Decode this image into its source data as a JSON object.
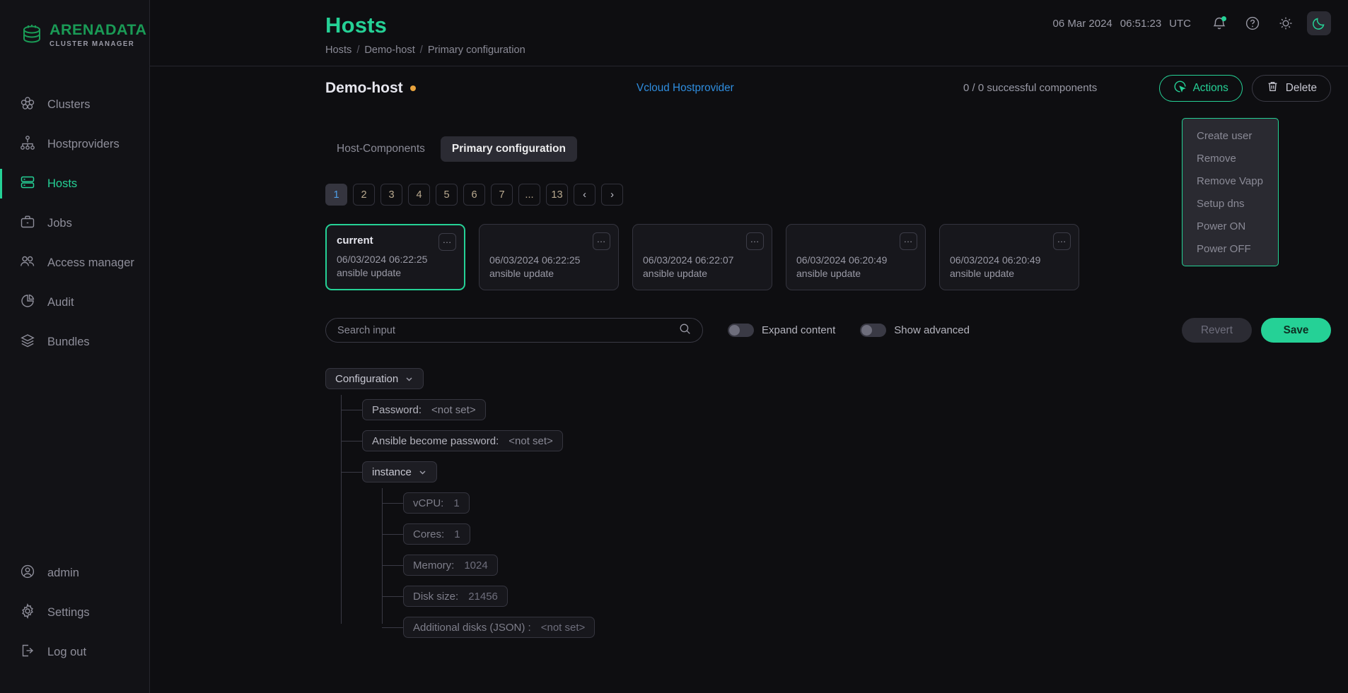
{
  "brand": {
    "name": "ARENADATA",
    "tagline": "CLUSTER MANAGER",
    "accent": "#25d196",
    "logo_icon": "database-stack-icon"
  },
  "sidebar": {
    "items": [
      {
        "label": "Clusters",
        "icon": "clusters-icon",
        "active": false
      },
      {
        "label": "Hostproviders",
        "icon": "hostproviders-icon",
        "active": false
      },
      {
        "label": "Hosts",
        "icon": "hosts-icon",
        "active": true
      },
      {
        "label": "Jobs",
        "icon": "jobs-briefcase-icon",
        "active": false
      },
      {
        "label": "Access manager",
        "icon": "users-icon",
        "active": false
      },
      {
        "label": "Audit",
        "icon": "audit-piechart-icon",
        "active": false
      },
      {
        "label": "Bundles",
        "icon": "bundles-layers-icon",
        "active": false
      }
    ],
    "bottom_items": [
      {
        "label": "admin",
        "icon": "user-circle-icon"
      },
      {
        "label": "Settings",
        "icon": "gear-icon"
      },
      {
        "label": "Log out",
        "icon": "logout-icon"
      }
    ]
  },
  "header": {
    "title": "Hosts",
    "breadcrumb": [
      "Hosts",
      "Demo-host",
      "Primary configuration"
    ],
    "breadcrumb_separator": "/",
    "date": "06 Mar 2024",
    "time": "06:51:23",
    "timezone": "UTC",
    "icons": {
      "bell": "bell-icon",
      "help": "help-circle-icon",
      "light": "sun-icon",
      "dark": "moon-icon"
    }
  },
  "host": {
    "name": "Demo-host",
    "status_color": "#e8a33d",
    "provider": "Vcloud Hostprovider",
    "components_status": "0 / 0 successful components",
    "actions_button": "Actions",
    "delete_button": "Delete"
  },
  "actions_menu": {
    "open": true,
    "items": [
      "Create user",
      "Remove",
      "Remove Vapp",
      "Setup dns",
      "Power ON",
      "Power OFF"
    ]
  },
  "tabs": [
    {
      "label": "Host-Components",
      "active": false
    },
    {
      "label": "Primary configuration",
      "active": true
    }
  ],
  "pagination": {
    "pages": [
      "1",
      "2",
      "3",
      "4",
      "5",
      "6",
      "7",
      "...",
      "13"
    ],
    "active": "1",
    "prev": "‹",
    "next": "›"
  },
  "versions": [
    {
      "title": "current",
      "date": "06/03/2024 06:22:25",
      "description": "ansible update",
      "current": true,
      "menu": "…"
    },
    {
      "title": "",
      "date": "06/03/2024 06:22:25",
      "description": "ansible update",
      "current": false,
      "menu": "…"
    },
    {
      "title": "",
      "date": "06/03/2024 06:22:07",
      "description": "ansible update",
      "current": false,
      "menu": "…"
    },
    {
      "title": "",
      "date": "06/03/2024 06:20:49",
      "description": "ansible update",
      "current": false,
      "menu": "…"
    },
    {
      "title": "",
      "date": "06/03/2024 06:20:49",
      "description": "ansible update",
      "current": false,
      "menu": "…"
    }
  ],
  "toolbar": {
    "search_placeholder": "Search input",
    "search_value": "",
    "search_icon": "search-icon",
    "expand_content_label": "Expand content",
    "expand_content_on": false,
    "show_advanced_label": "Show advanced",
    "show_advanced_on": false,
    "revert_label": "Revert",
    "save_label": "Save"
  },
  "config_tree": {
    "root": {
      "label": "Configuration",
      "expanded": true
    },
    "fields": [
      {
        "name": "Password:",
        "value": "<not set>",
        "dim": false
      },
      {
        "name": "Ansible become password:",
        "value": "<not set>",
        "dim": false
      }
    ],
    "instance": {
      "label": "instance",
      "expanded": true,
      "fields": [
        {
          "name": "vCPU:",
          "value": "1",
          "dim": true
        },
        {
          "name": "Cores:",
          "value": "1",
          "dim": true
        },
        {
          "name": "Memory:",
          "value": "1024",
          "dim": true
        },
        {
          "name": "Disk size:",
          "value": "21456",
          "dim": true
        },
        {
          "name": "Additional disks (JSON) :",
          "value": "<not set>",
          "dim": true
        }
      ]
    }
  }
}
